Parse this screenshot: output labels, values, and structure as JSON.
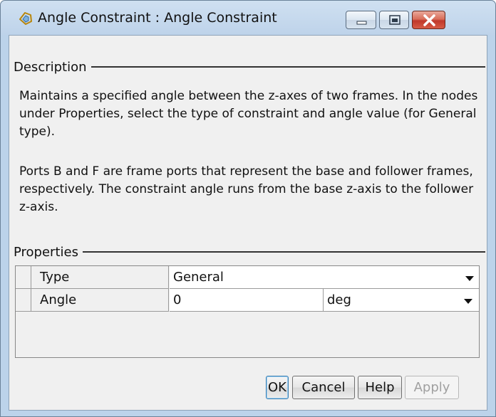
{
  "window": {
    "title": "Angle Constraint : Angle Constraint"
  },
  "description": {
    "header": "Description",
    "paragraph1": "Maintains a specified angle between the z-axes of two frames. In the nodes under Properties, select the type of constraint and angle value (for General type).",
    "paragraph2": "Ports B and F are frame ports that represent the base and follower frames, respectively. The constraint angle runs from the base z-axis to the follower z-axis."
  },
  "properties": {
    "header": "Properties",
    "rows": [
      {
        "label": "Type",
        "value": "General"
      },
      {
        "label": "Angle",
        "value": "0",
        "unit": "deg"
      }
    ]
  },
  "buttons": {
    "ok": "OK",
    "cancel": "Cancel",
    "help": "Help",
    "apply": "Apply"
  },
  "icons": {
    "app": "angle-constraint-icon",
    "minimize": "minimize-icon",
    "maximize": "maximize-icon",
    "close": "close-icon",
    "dropdown": "chevron-down-icon"
  },
  "colors": {
    "titlebar": "#bed3ea",
    "close_button": "#c0392b",
    "dialog_background": "#f0f0f0",
    "disabled_text": "#a0a0a0"
  }
}
